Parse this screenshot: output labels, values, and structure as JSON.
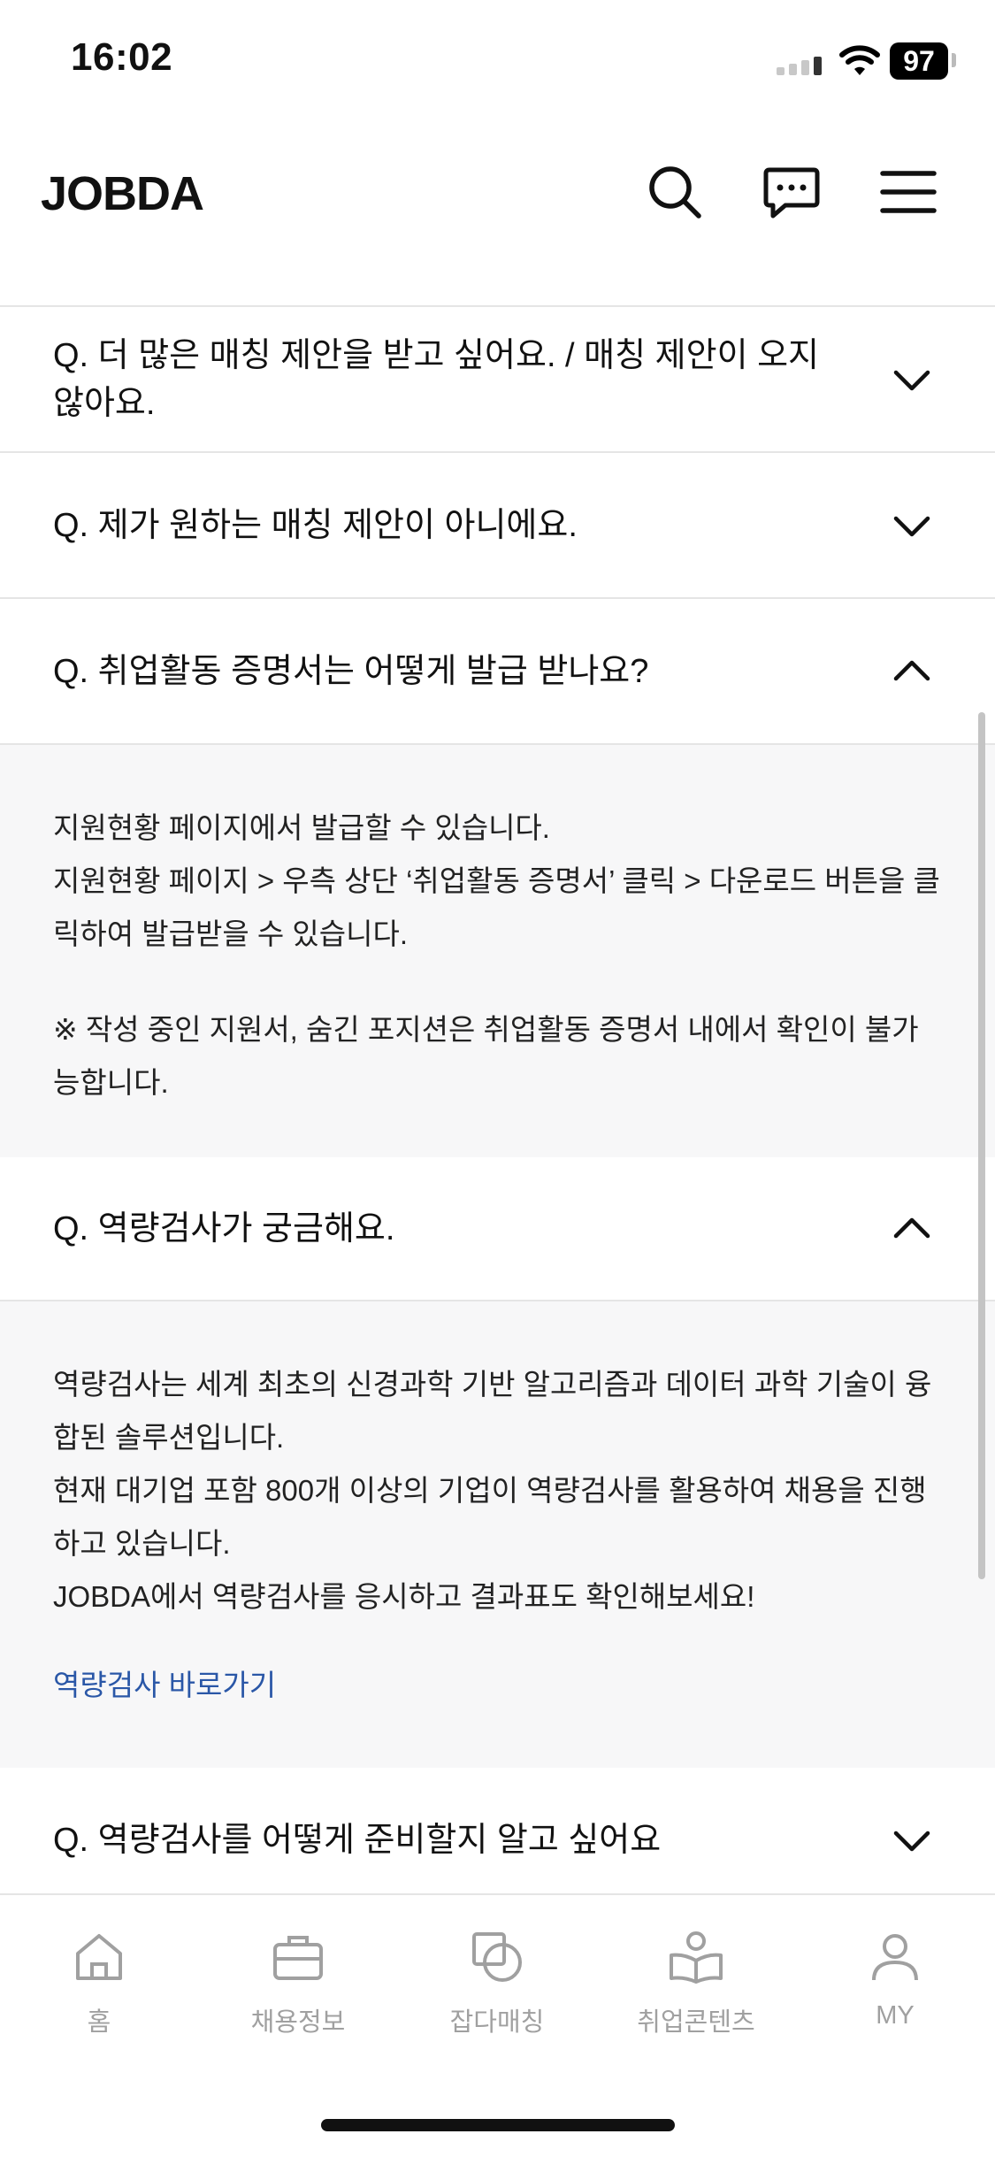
{
  "status": {
    "time": "16:02",
    "battery": "97"
  },
  "header": {
    "logo": "JOBDA",
    "icons": [
      "search-icon",
      "chat-icon",
      "menu-icon"
    ]
  },
  "faq": [
    {
      "q": "Q. 더 많은 매칭 제안을 받고 싶어요. / 매칭 제안이 오지 않아요.",
      "expanded": false
    },
    {
      "q": "Q. 제가 원하는 매칭 제안이 아니에요.",
      "expanded": false
    },
    {
      "q": "Q. 취업활동 증명서는 어떻게 발급 받나요?",
      "expanded": true,
      "a": [
        "지원현황 페이지에서 발급할 수 있습니다.",
        "지원현황 페이지 > 우측 상단 ‘취업활동 증명서’ 클릭 > 다운로드 버튼을 클릭하여 발급받을 수 있습니다.",
        "※ 작성 중인 지원서, 숨긴 포지션은 취업활동 증명서 내에서 확인이 불가능합니다."
      ]
    },
    {
      "q": "Q. 역량검사가 궁금해요.",
      "expanded": true,
      "a": [
        "역량검사는 세계 최초의 신경과학 기반 알고리즘과 데이터 과학 기술이 융합된 솔루션입니다.",
        "현재 대기업 포함 800개 이상의 기업이 역량검사를 활용하여 채용을 진행하고 있습니다.",
        "JOBDA에서 역량검사를 응시하고 결과표도 확인해보세요!"
      ],
      "link": "역량검사 바로가기"
    },
    {
      "q": "Q. 역량검사를 어떻게 준비할지 알고 싶어요",
      "expanded": false
    }
  ],
  "tabbar": [
    {
      "label": "홈",
      "icon": "home-icon"
    },
    {
      "label": "채용정보",
      "icon": "briefcase-icon"
    },
    {
      "label": "잡다매칭",
      "icon": "matching-icon"
    },
    {
      "label": "취업콘텐츠",
      "icon": "content-icon"
    },
    {
      "label": "MY",
      "icon": "profile-icon"
    }
  ],
  "colors": {
    "link": "#2a57a7",
    "answer_bg": "#f7f7f8",
    "tab_inactive": "#a0a0a0"
  }
}
